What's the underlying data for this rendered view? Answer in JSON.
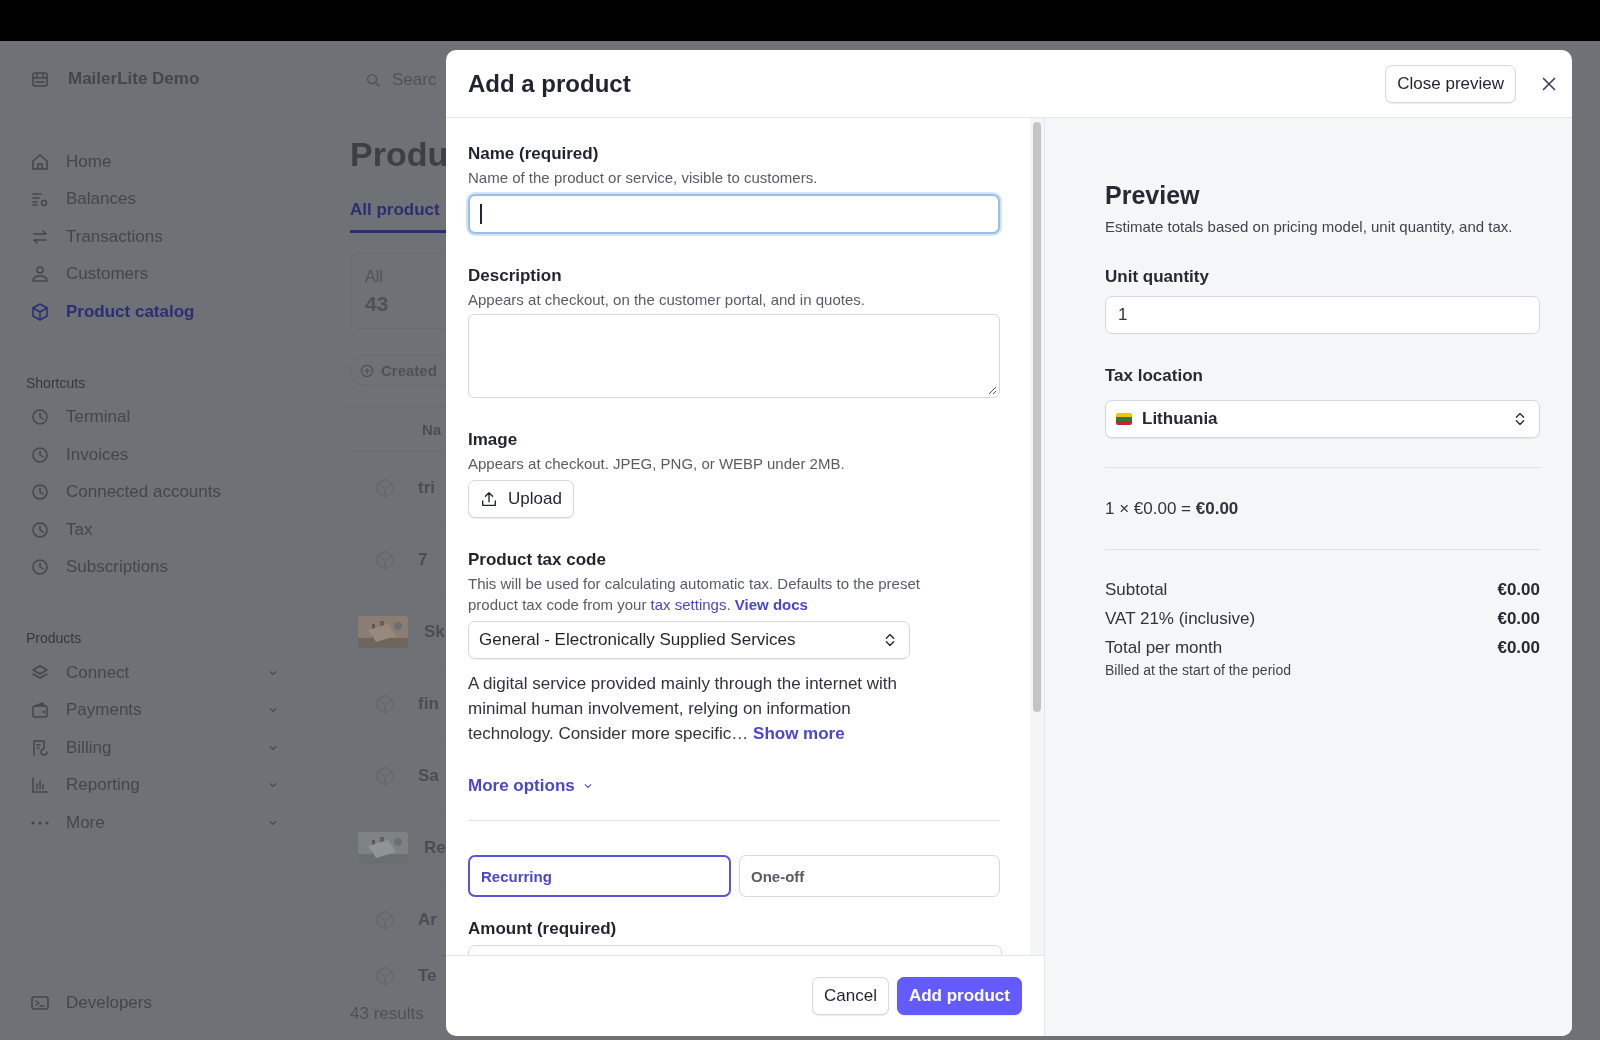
{
  "sidebar": {
    "account": "MailerLite Demo",
    "main_items": [
      {
        "label": "Home",
        "selected": false
      },
      {
        "label": "Balances",
        "selected": false
      },
      {
        "label": "Transactions",
        "selected": false
      },
      {
        "label": "Customers",
        "selected": false
      },
      {
        "label": "Product catalog",
        "selected": true
      }
    ],
    "sections": [
      {
        "title": "Shortcuts",
        "items": [
          {
            "label": "Terminal",
            "kind": "link"
          },
          {
            "label": "Invoices",
            "kind": "link"
          },
          {
            "label": "Connected accounts",
            "kind": "link"
          },
          {
            "label": "Tax",
            "kind": "link"
          },
          {
            "label": "Subscriptions",
            "kind": "link"
          }
        ]
      },
      {
        "title": "Products",
        "items": [
          {
            "label": "Connect",
            "kind": "group"
          },
          {
            "label": "Payments",
            "kind": "group"
          },
          {
            "label": "Billing",
            "kind": "group"
          },
          {
            "label": "Reporting",
            "kind": "group"
          },
          {
            "label": "More",
            "kind": "group"
          }
        ]
      }
    ],
    "footer": "Developers"
  },
  "main": {
    "search_placeholder": "Searc",
    "title": "Produ",
    "tab": {
      "label": "All product",
      "selected": true
    },
    "summary": {
      "label": "All",
      "count": "43"
    },
    "filter": "Created",
    "column": "Na",
    "rows": [
      {
        "name": "tri",
        "kind": "icon"
      },
      {
        "name": "7",
        "kind": "icon"
      },
      {
        "name": "Sk",
        "kind": "picture"
      },
      {
        "name": "fin",
        "kind": "icon"
      },
      {
        "name": "Sa",
        "kind": "icon"
      },
      {
        "name": "Re",
        "kind": "picture"
      },
      {
        "name": "Ar",
        "kind": "icon"
      },
      {
        "name": "Te",
        "kind": "icon"
      }
    ],
    "results": "43 results"
  },
  "modal": {
    "title": "Add a product",
    "close_preview": "Close preview",
    "name": {
      "label": "Name (required)",
      "help": "Name of the product or service, visible to customers.",
      "focused": true
    },
    "description": {
      "label": "Description",
      "help": "Appears at checkout, on the customer portal, and in quotes."
    },
    "image": {
      "label": "Image",
      "help": "Appears at checkout. JPEG, PNG, or WEBP under 2MB.",
      "button": "Upload"
    },
    "tax_code": {
      "label": "Product tax code",
      "help": [
        {
          "text": "This will be used for calculating automatic tax. Defaults to the preset product tax code from your ",
          "kind": "text"
        },
        {
          "text": "tax settings",
          "kind": "link"
        },
        {
          "text": ". ",
          "kind": "text"
        },
        {
          "text": "View docs",
          "kind": "strong-link"
        }
      ],
      "value": "General - Electronically Supplied Services",
      "info": "A digital service provided mainly through the internet with minimal human involvement, relying on information technology. Consider more specific…",
      "show_more": "Show more"
    },
    "more_options": "More options",
    "pricing_types": [
      {
        "label": "Recurring",
        "selected": true
      },
      {
        "label": "One-off",
        "selected": false
      }
    ],
    "amount_label": "Amount (required)",
    "buttons": [
      {
        "label": "Cancel",
        "kind": "secondary"
      },
      {
        "label": "Add product",
        "kind": "primary"
      }
    ]
  },
  "preview": {
    "title": "Preview",
    "subtitle": "Estimate totals based on pricing model, unit quantity, and tax.",
    "quantity_label": "Unit quantity",
    "quantity": "1",
    "location_label": "Tax location",
    "location": "Lithuania",
    "formula": "1 × €0.00 = **€0.00**",
    "lines": [
      {
        "label": "Subtotal",
        "value": "€0.00"
      },
      {
        "label": "VAT 21% (inclusive)",
        "value": "€0.00"
      },
      {
        "label": "Total per month",
        "value": "€0.00",
        "note": "Billed at the start of the period"
      }
    ]
  }
}
